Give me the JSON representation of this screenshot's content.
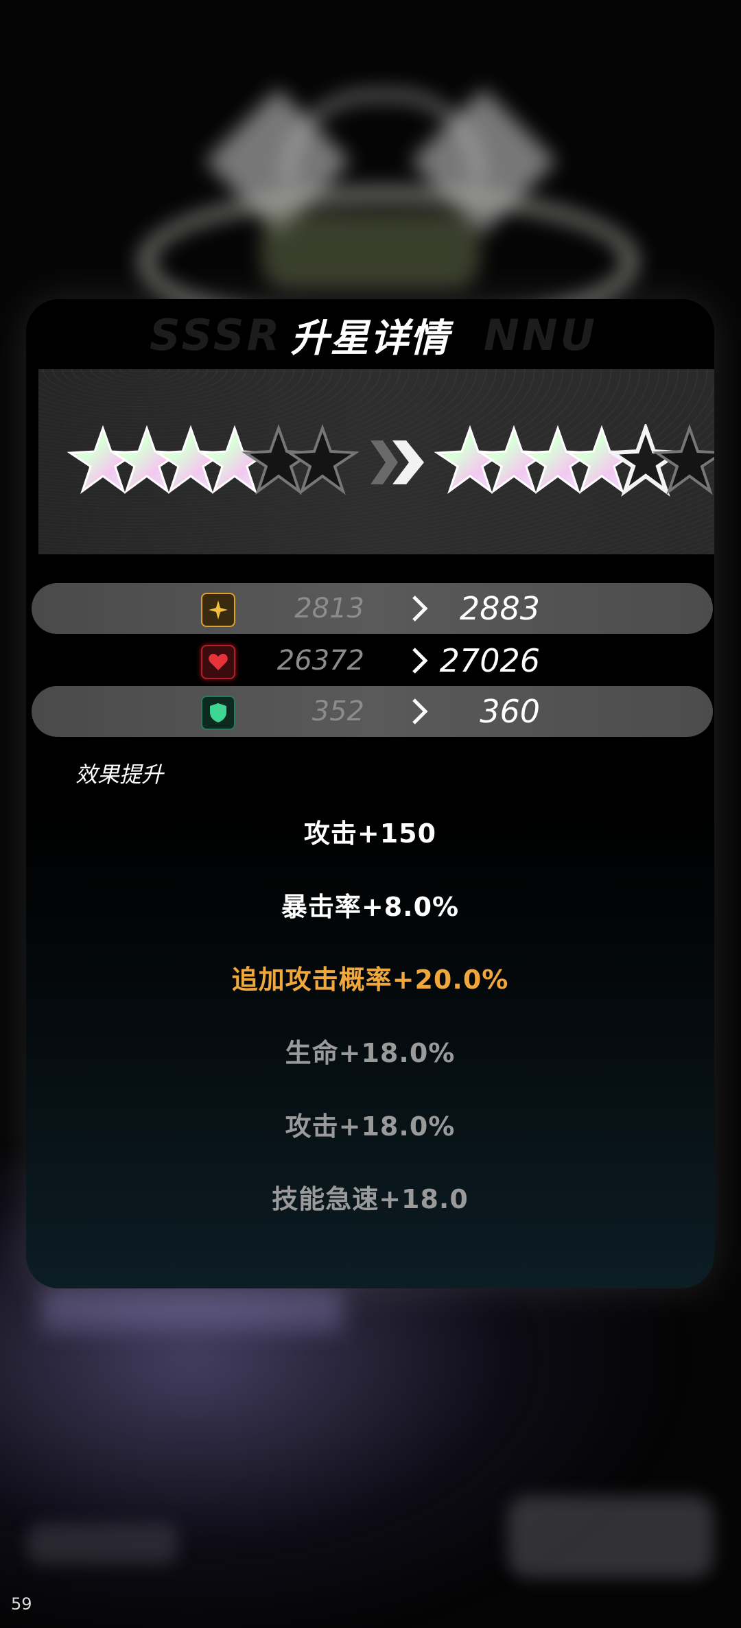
{
  "panel": {
    "title": "升星详情",
    "stars_from": {
      "filled": 4,
      "total": 6
    },
    "stars_to": {
      "filled": 4,
      "outlined_new": 1,
      "total": 6
    }
  },
  "stats": [
    {
      "icon": "attack-icon",
      "old": "2813",
      "new": "2883",
      "color": "#e0a030"
    },
    {
      "icon": "heart-icon",
      "old": "26372",
      "new": "27026",
      "color": "#d0282c"
    },
    {
      "icon": "shield-icon",
      "old": "352",
      "new": "360",
      "color": "#2fbf7a"
    }
  ],
  "effects": {
    "heading": "效果提升",
    "items": [
      {
        "text": "攻击+150",
        "color": "#ffffff"
      },
      {
        "text": "暴击率+8.0%",
        "color": "#ffffff"
      },
      {
        "text": "追加攻击概率+20.0%",
        "color": "#f0a83c"
      },
      {
        "text": "生命+18.0%",
        "color": "#9a9a9a"
      },
      {
        "text": "攻击+18.0%",
        "color": "#9a9a9a"
      },
      {
        "text": "技能急速+18.0",
        "color": "#9a9a9a"
      }
    ]
  },
  "footer": {
    "page_number": "59"
  }
}
